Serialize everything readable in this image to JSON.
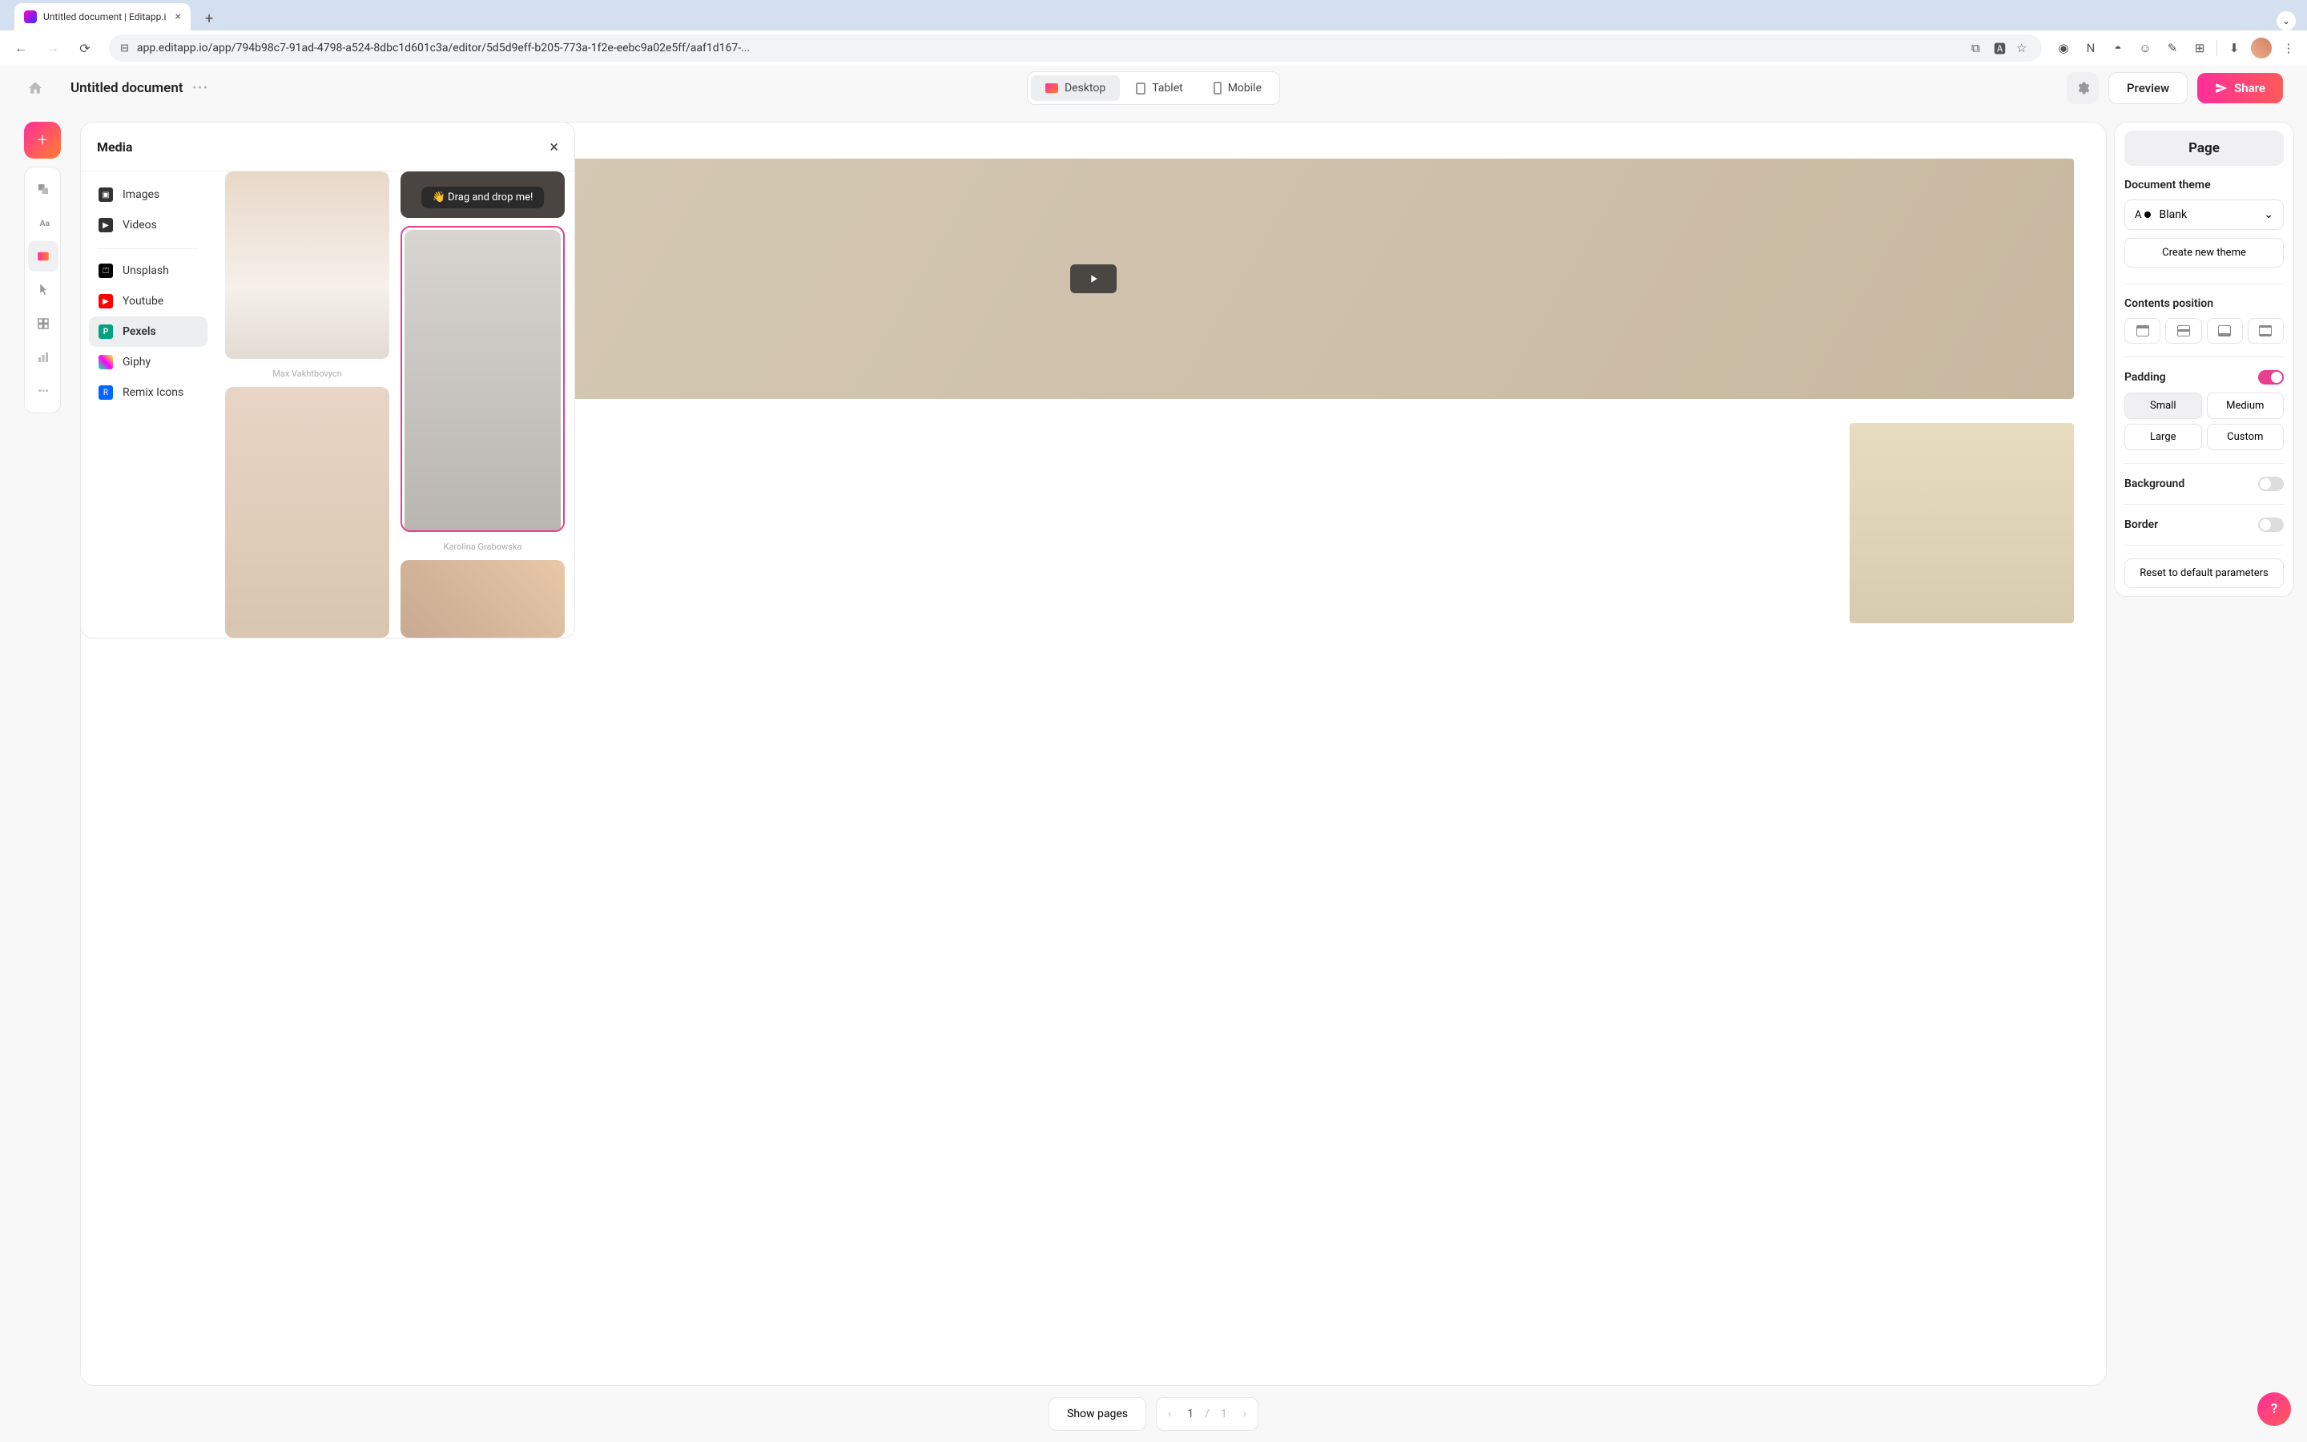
{
  "browser": {
    "tab_title": "Untitled document | Editapp.i",
    "url": "app.editapp.io/app/794b98c7-91ad-4798-a524-8dbc1d601c3a/editor/5d5d9eff-b205-773a-1f2e-eebc9a02e5ff/aaf1d167-..."
  },
  "header": {
    "document_title": "Untitled document",
    "devices": {
      "desktop": "Desktop",
      "tablet": "Tablet",
      "mobile": "Mobile"
    },
    "preview": "Preview",
    "share": "Share"
  },
  "media_panel": {
    "title": "Media",
    "nav_groups": {
      "local": [
        "Images",
        "Videos"
      ],
      "sources": [
        "Unsplash",
        "Youtube",
        "Pexels",
        "Giphy",
        "Remix Icons"
      ]
    },
    "active_source": "Pexels",
    "drag_tooltip": "👋 Drag and drop me!",
    "credits": {
      "credit1": "Max Vakhtbovycn",
      "credit2": "Karolina Grabowska"
    }
  },
  "right_panel": {
    "title": "Page",
    "theme_section": "Document theme",
    "theme_value": "Blank",
    "create_theme": "Create new theme",
    "contents_position": "Contents position",
    "padding_label": "Padding",
    "padding_options": {
      "small": "Small",
      "medium": "Medium",
      "large": "Large",
      "custom": "Custom"
    },
    "padding_active": "Small",
    "background_label": "Background",
    "border_label": "Border",
    "padding_on": true,
    "background_on": false,
    "border_on": false,
    "reset": "Reset to default parameters"
  },
  "footer": {
    "show_pages": "Show pages",
    "current_page": "1",
    "total_pages": "1"
  },
  "help": "?"
}
